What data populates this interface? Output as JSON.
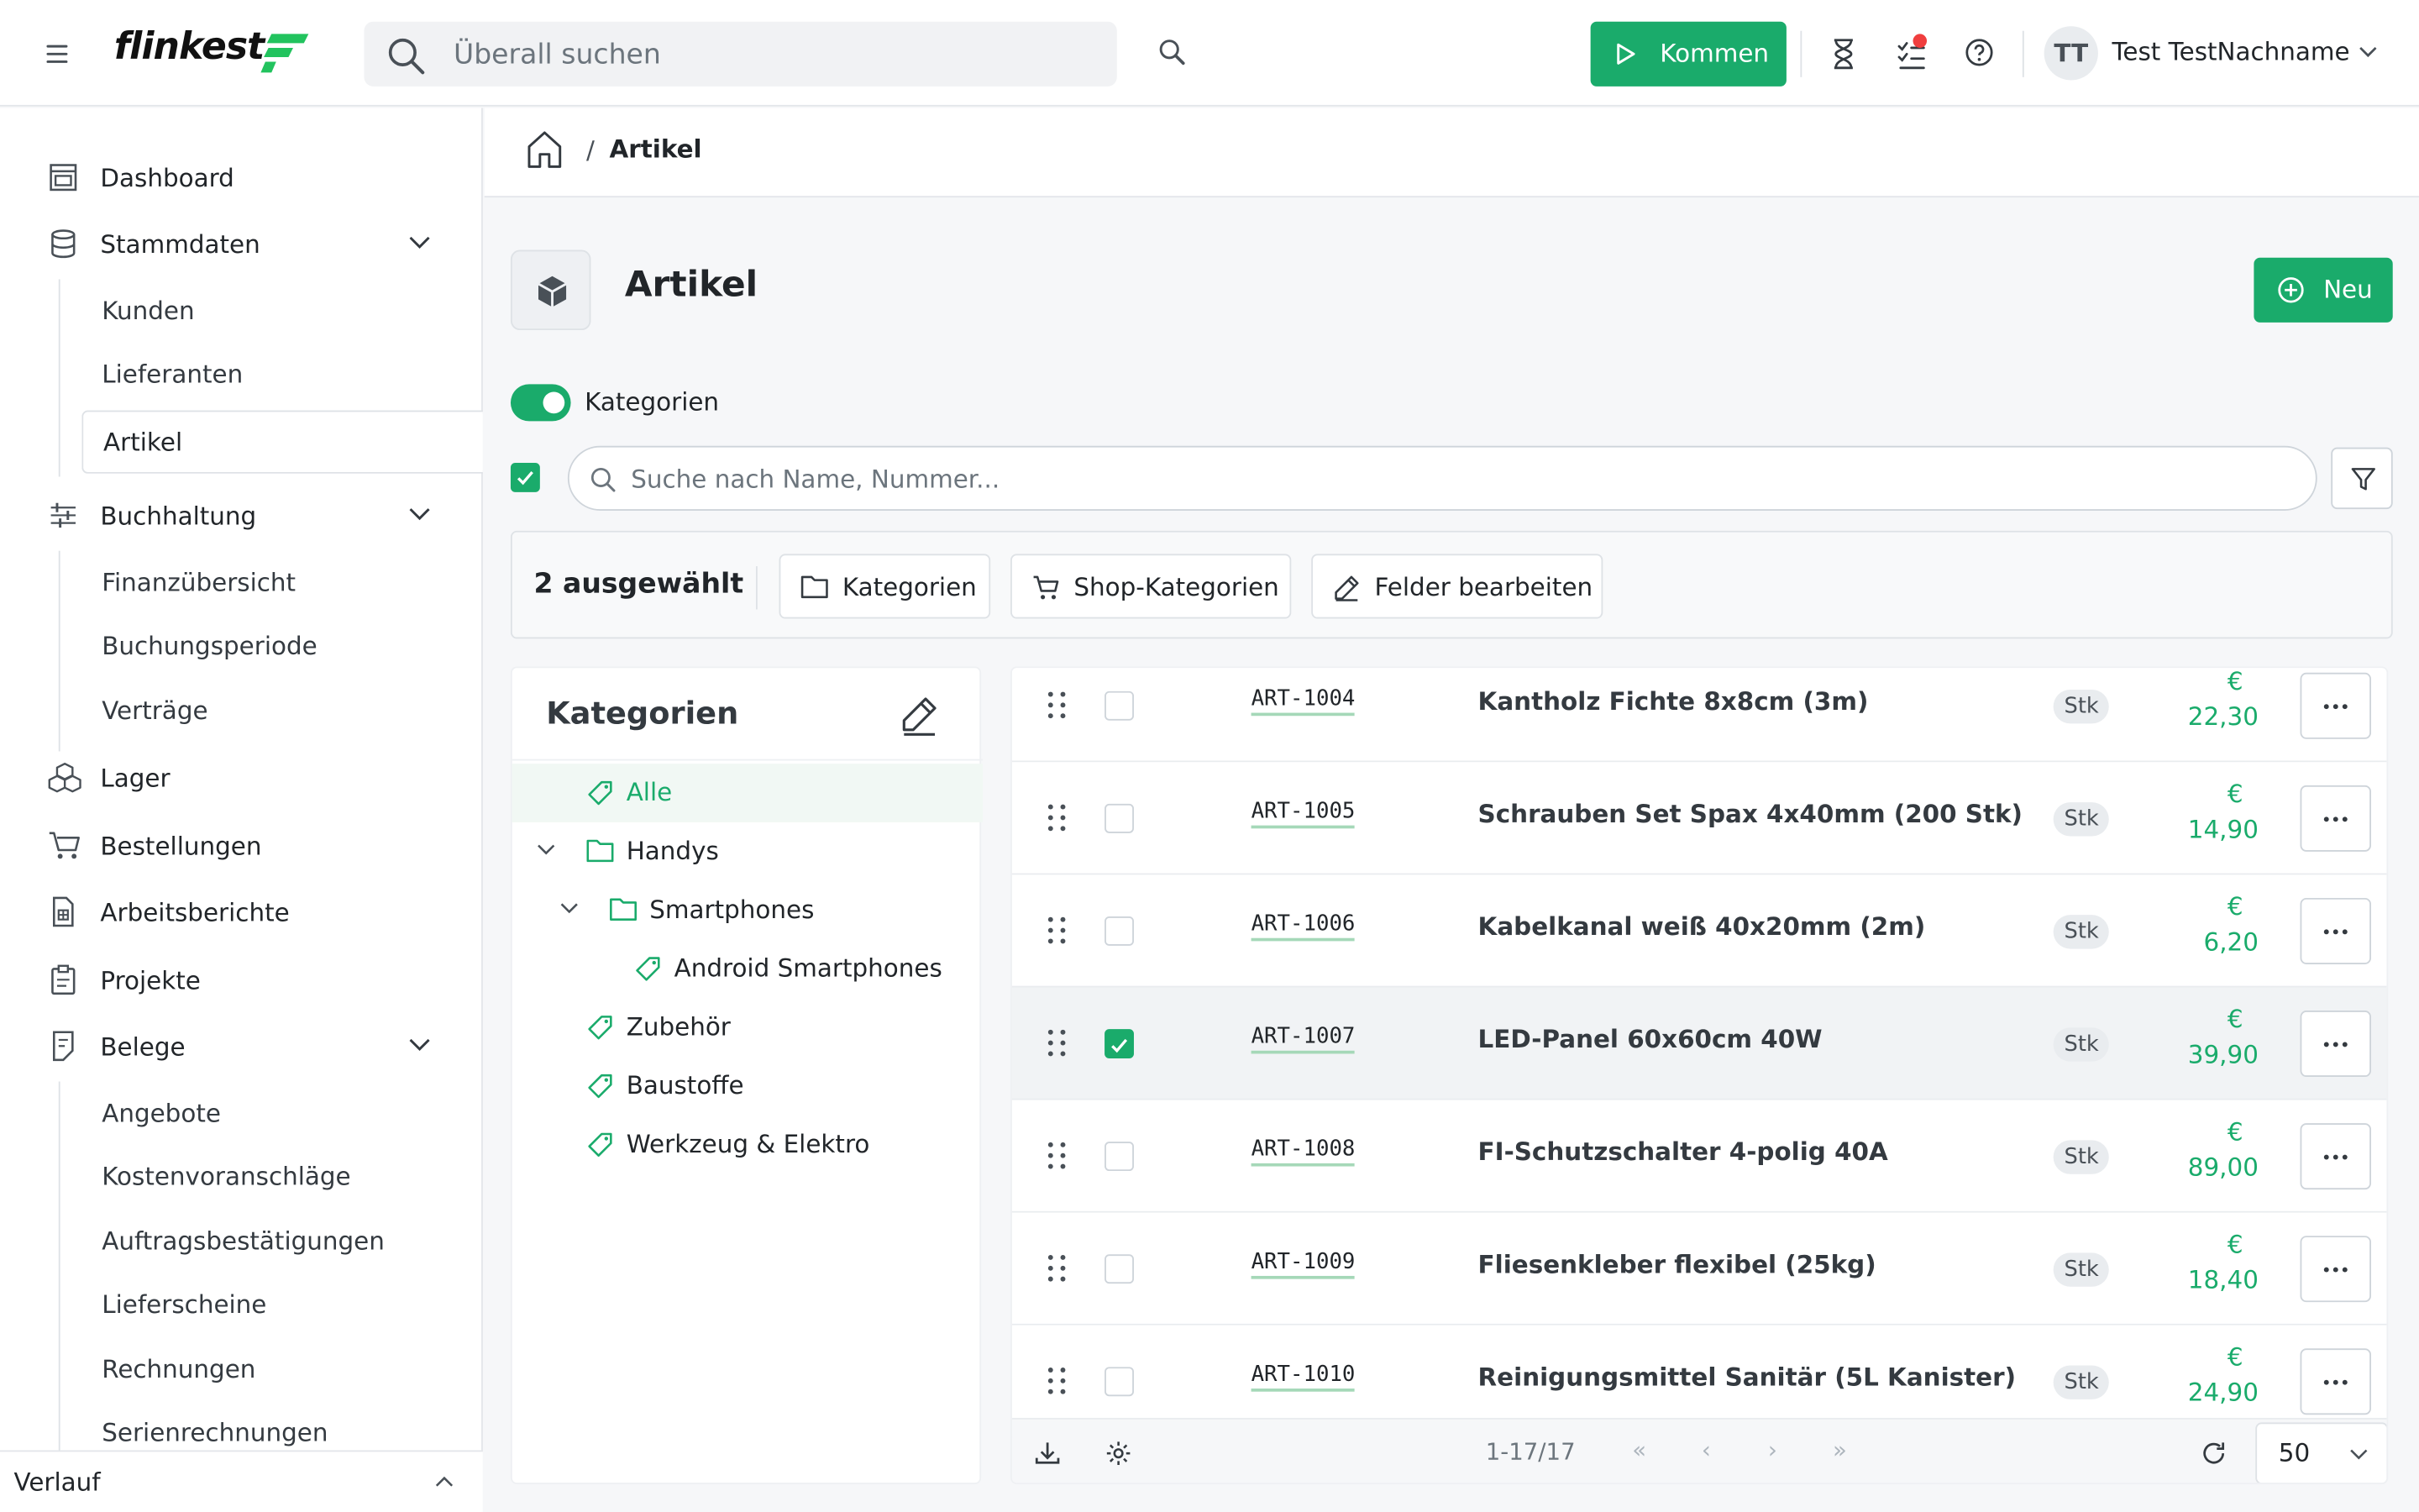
{
  "header": {
    "logo_text": "flinkest",
    "search_placeholder": "Überall suchen",
    "kommen_label": "Kommen",
    "user_initials": "TT",
    "user_name": "Test TestNachname"
  },
  "sidebar": {
    "items": [
      {
        "label": "Dashboard"
      },
      {
        "label": "Stammdaten"
      },
      {
        "label": "Buchhaltung"
      },
      {
        "label": "Lager"
      },
      {
        "label": "Bestellungen"
      },
      {
        "label": "Arbeitsberichte"
      },
      {
        "label": "Projekte"
      },
      {
        "label": "Belege"
      }
    ],
    "stammdaten_sub": [
      "Kunden",
      "Lieferanten",
      "Artikel"
    ],
    "buchhaltung_sub": [
      "Finanzübersicht",
      "Buchungsperiode",
      "Verträge"
    ],
    "belege_sub": [
      "Angebote",
      "Kostenvoranschläge",
      "Auftragsbestätigungen",
      "Lieferscheine",
      "Rechnungen",
      "Serienrechnungen"
    ],
    "verlauf_label": "Verlauf"
  },
  "breadcrumb": {
    "separator": "/",
    "current": "Artikel"
  },
  "page": {
    "title": "Artikel",
    "new_label": "Neu",
    "toggle_label": "Kategorien",
    "search_placeholder": "Suche nach Name, Nummer..."
  },
  "selection": {
    "count_label": "2 ausgewählt",
    "actions": [
      "Kategorien",
      "Shop-Kategorien",
      "Felder bearbeiten"
    ]
  },
  "categories": {
    "title": "Kategorien",
    "items": [
      "Alle",
      "Handys",
      "Smartphones",
      "Android Smartphones",
      "Zubehör",
      "Baustoffe",
      "Werkzeug & Elektro"
    ]
  },
  "table": {
    "rows": [
      {
        "number": "ART-1004",
        "name": "Kantholz Fichte 8x8cm (3m)",
        "unit": "Stk",
        "currency": "€",
        "price": "22,30",
        "selected": false
      },
      {
        "number": "ART-1005",
        "name": "Schrauben Set Spax 4x40mm (200 Stk)",
        "unit": "Stk",
        "currency": "€",
        "price": "14,90",
        "selected": false
      },
      {
        "number": "ART-1006",
        "name": "Kabelkanal weiß 40x20mm (2m)",
        "unit": "Stk",
        "currency": "€",
        "price": "6,20",
        "selected": false
      },
      {
        "number": "ART-1007",
        "name": "LED-Panel 60x60cm 40W",
        "unit": "Stk",
        "currency": "€",
        "price": "39,90",
        "selected": true
      },
      {
        "number": "ART-1008",
        "name": "FI-Schutzschalter 4-polig 40A",
        "unit": "Stk",
        "currency": "€",
        "price": "89,00",
        "selected": false
      },
      {
        "number": "ART-1009",
        "name": "Fliesenkleber flexibel (25kg)",
        "unit": "Stk",
        "currency": "€",
        "price": "18,40",
        "selected": false
      },
      {
        "number": "ART-1010",
        "name": "Reinigungsmittel Sanitär (5L Kanister)",
        "unit": "Stk",
        "currency": "€",
        "price": "24,90",
        "selected": false
      }
    ],
    "footer": {
      "range": "1-17/17",
      "first": "«",
      "prev": "‹",
      "next": "›",
      "last": "»",
      "page_size": "50"
    }
  },
  "colors": {
    "accent": "#1aab6b",
    "notification": "#f03e3e"
  }
}
